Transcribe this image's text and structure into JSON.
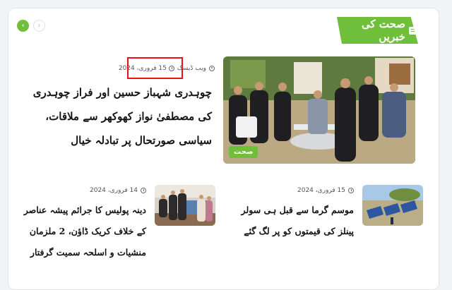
{
  "section": {
    "title": "صحت کی خبریں",
    "icon": "document-icon"
  },
  "nav": {
    "prev_icon": "‹",
    "next_icon": "›"
  },
  "featured": {
    "category_badge": "صحت",
    "author": "ویب ڈیسک",
    "date": "15 فروری، 2024",
    "title": "چوہدری شہباز حسین اور فراز چوہدری کی مصطفیٰ نواز کھوکھر سے ملاقات، سیاسی صورتحال پر تبادلہ خیال"
  },
  "items": [
    {
      "date": "15 فروری، 2024",
      "title": "موسم گرما سے قبل ہی سولر پینلز کی قیمتوں کو پر لگ گئے"
    },
    {
      "date": "14 فروری، 2024",
      "title": "دینہ پولیس کا جرائم پیشہ عناصر کے خلاف کریک ڈاؤن، 2 ملزمان منشیات و اسلحہ سمیت گرفتار"
    }
  ],
  "colors": {
    "accent": "#6fbf3a",
    "highlight": "#ee1111"
  }
}
